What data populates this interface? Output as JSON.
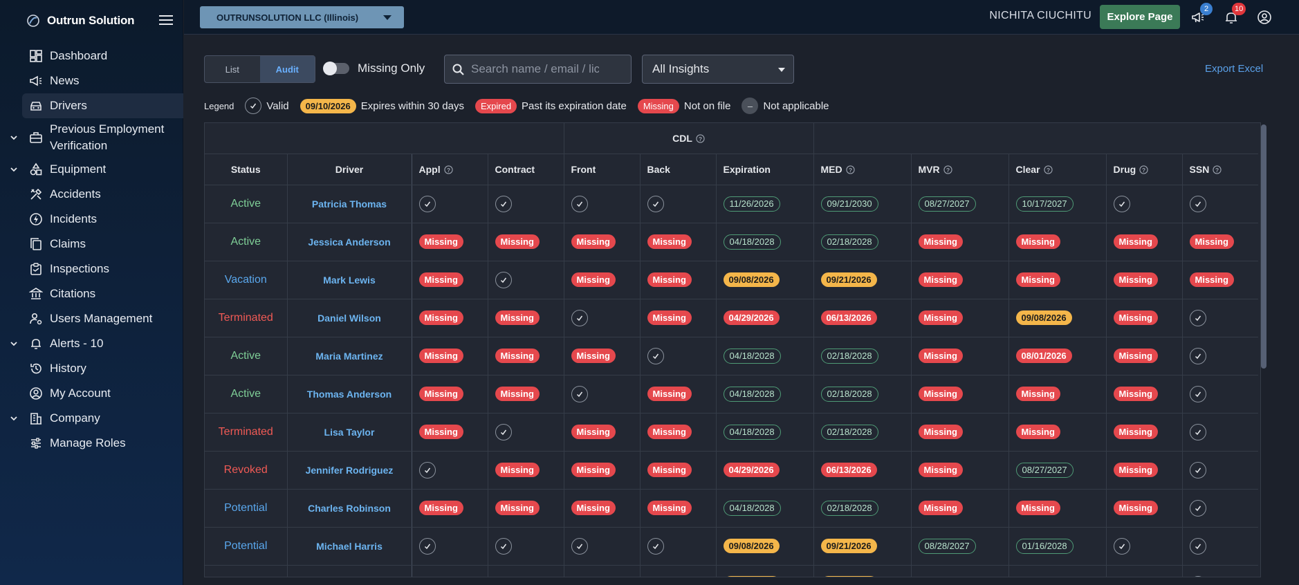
{
  "app": {
    "name": "Outrun Solution"
  },
  "sidebar": {
    "items": [
      {
        "label": "Dashboard",
        "icon": "dashboard-icon"
      },
      {
        "label": "News",
        "icon": "megaphone-icon"
      },
      {
        "label": "Drivers",
        "icon": "car-icon",
        "active": true
      },
      {
        "label": "Previous Employment Verification",
        "icon": "briefcase-icon",
        "expandable": true
      },
      {
        "label": "Equipment",
        "icon": "shapes-icon",
        "expandable": true
      },
      {
        "label": "Accidents",
        "icon": "tools-icon"
      },
      {
        "label": "Incidents",
        "icon": "bolt-icon"
      },
      {
        "label": "Claims",
        "icon": "copy-icon"
      },
      {
        "label": "Inspections",
        "icon": "clipboard-icon"
      },
      {
        "label": "Citations",
        "icon": "bank-icon"
      },
      {
        "label": "Users Management",
        "icon": "user-gear-icon"
      },
      {
        "label": "Alerts - 10",
        "icon": "bell-icon",
        "expandable": true
      },
      {
        "label": "History",
        "icon": "history-icon"
      },
      {
        "label": "My Account",
        "icon": "account-circle-icon"
      },
      {
        "label": "Company",
        "icon": "building-icon",
        "expandable": true
      },
      {
        "label": "Manage Roles",
        "icon": "sliders-icon"
      }
    ]
  },
  "topbar": {
    "company": "OUTRUNSOLUTION LLC (Illinois)",
    "user": "NICHITA CIUCHITU",
    "explore_label": "Explore Page",
    "news_count": "2",
    "alerts_count": "10"
  },
  "toolbar": {
    "view_list": "List",
    "view_audit": "Audit",
    "missing_only": "Missing Only",
    "search_placeholder": "Search name / email / lic",
    "insights": "All Insights",
    "export": "Export Excel"
  },
  "legend": {
    "title": "Legend",
    "valid": "Valid",
    "expiring_sample": "09/10/2026",
    "expiring": "Expires within 30 days",
    "expired_sample": "Expired",
    "expired": "Past its expiration date",
    "missing_sample": "Missing",
    "missing": "Not on file",
    "na_sample": "–",
    "na": "Not applicable"
  },
  "table": {
    "group_header": "CDL",
    "columns": [
      "Status",
      "Driver",
      "Appl",
      "Contract",
      "Front",
      "Back",
      "Expiration",
      "MED",
      "MVR",
      "Clear",
      "Drug",
      "SSN"
    ],
    "rows": [
      {
        "status": "Active",
        "driver": "Patricia Thomas",
        "cells": [
          [
            "ok"
          ],
          [
            "ok"
          ],
          [
            "ok"
          ],
          [
            "ok"
          ],
          [
            "v",
            "11/26/2026"
          ],
          [
            "v",
            "09/21/2030"
          ],
          [
            "v",
            "08/27/2027"
          ],
          [
            "v",
            "10/17/2027"
          ],
          [
            "ok"
          ],
          [
            "ok"
          ]
        ]
      },
      {
        "status": "Active",
        "driver": "Jessica Anderson",
        "cells": [
          [
            "m"
          ],
          [
            "m"
          ],
          [
            "m"
          ],
          [
            "m"
          ],
          [
            "v",
            "04/18/2028"
          ],
          [
            "v",
            "02/18/2028"
          ],
          [
            "m"
          ],
          [
            "m"
          ],
          [
            "m"
          ],
          [
            "m"
          ]
        ]
      },
      {
        "status": "Vacation",
        "driver": "Mark Lewis",
        "cells": [
          [
            "m"
          ],
          [
            "ok"
          ],
          [
            "m"
          ],
          [
            "m"
          ],
          [
            "y",
            "09/08/2026"
          ],
          [
            "y",
            "09/21/2026"
          ],
          [
            "m"
          ],
          [
            "m"
          ],
          [
            "m"
          ],
          [
            "m"
          ]
        ]
      },
      {
        "status": "Terminated",
        "driver": "Daniel Wilson",
        "cells": [
          [
            "m"
          ],
          [
            "m"
          ],
          [
            "ok"
          ],
          [
            "m"
          ],
          [
            "e",
            "04/29/2026"
          ],
          [
            "e",
            "06/13/2026"
          ],
          [
            "m"
          ],
          [
            "y",
            "09/08/2026"
          ],
          [
            "m"
          ],
          [
            "ok"
          ]
        ]
      },
      {
        "status": "Active",
        "driver": "Maria Martinez",
        "cells": [
          [
            "m"
          ],
          [
            "m"
          ],
          [
            "m"
          ],
          [
            "ok"
          ],
          [
            "v",
            "04/18/2028"
          ],
          [
            "v",
            "02/18/2028"
          ],
          [
            "m"
          ],
          [
            "e",
            "08/01/2026"
          ],
          [
            "m"
          ],
          [
            "ok"
          ]
        ]
      },
      {
        "status": "Active",
        "driver": "Thomas Anderson",
        "cells": [
          [
            "m"
          ],
          [
            "m"
          ],
          [
            "ok"
          ],
          [
            "m"
          ],
          [
            "v",
            "04/18/2028"
          ],
          [
            "v",
            "02/18/2028"
          ],
          [
            "m"
          ],
          [
            "m"
          ],
          [
            "m"
          ],
          [
            "ok"
          ]
        ]
      },
      {
        "status": "Terminated",
        "driver": "Lisa Taylor",
        "cells": [
          [
            "m"
          ],
          [
            "ok"
          ],
          [
            "m"
          ],
          [
            "m"
          ],
          [
            "v",
            "04/18/2028"
          ],
          [
            "v",
            "02/18/2028"
          ],
          [
            "m"
          ],
          [
            "m"
          ],
          [
            "m"
          ],
          [
            "ok"
          ]
        ]
      },
      {
        "status": "Revoked",
        "driver": "Jennifer Rodriguez",
        "cells": [
          [
            "ok"
          ],
          [
            "m"
          ],
          [
            "m"
          ],
          [
            "m"
          ],
          [
            "e",
            "04/29/2026"
          ],
          [
            "e",
            "06/13/2026"
          ],
          [
            "m"
          ],
          [
            "v",
            "08/27/2027"
          ],
          [
            "m"
          ],
          [
            "ok"
          ]
        ]
      },
      {
        "status": "Potential",
        "driver": "Charles Robinson",
        "cells": [
          [
            "m"
          ],
          [
            "m"
          ],
          [
            "m"
          ],
          [
            "m"
          ],
          [
            "v",
            "04/18/2028"
          ],
          [
            "v",
            "02/18/2028"
          ],
          [
            "m"
          ],
          [
            "m"
          ],
          [
            "m"
          ],
          [
            "ok"
          ]
        ]
      },
      {
        "status": "Potential",
        "driver": "Michael Harris",
        "cells": [
          [
            "ok"
          ],
          [
            "ok"
          ],
          [
            "ok"
          ],
          [
            "ok"
          ],
          [
            "y",
            "09/08/2026"
          ],
          [
            "y",
            "09/21/2026"
          ],
          [
            "v",
            "08/28/2027"
          ],
          [
            "v",
            "01/16/2028"
          ],
          [
            "ok"
          ],
          [
            "ok"
          ]
        ]
      },
      {
        "status": "",
        "driver": "",
        "cells": [
          [
            "m"
          ],
          [
            "m"
          ],
          [
            "m"
          ],
          [
            "m"
          ],
          [
            "y",
            ""
          ],
          [
            "y",
            ""
          ],
          [
            "m"
          ],
          [
            "m"
          ],
          [
            "m"
          ],
          [
            "ok"
          ]
        ]
      }
    ],
    "missing_label": "Missing",
    "colors": {
      "missing": "#e5484d",
      "expiring": "#f4b64a",
      "valid_border": "#4f9b76",
      "active": "#7fcf97",
      "terminated": "#f05a55",
      "potential": "#5aa8ee"
    }
  }
}
